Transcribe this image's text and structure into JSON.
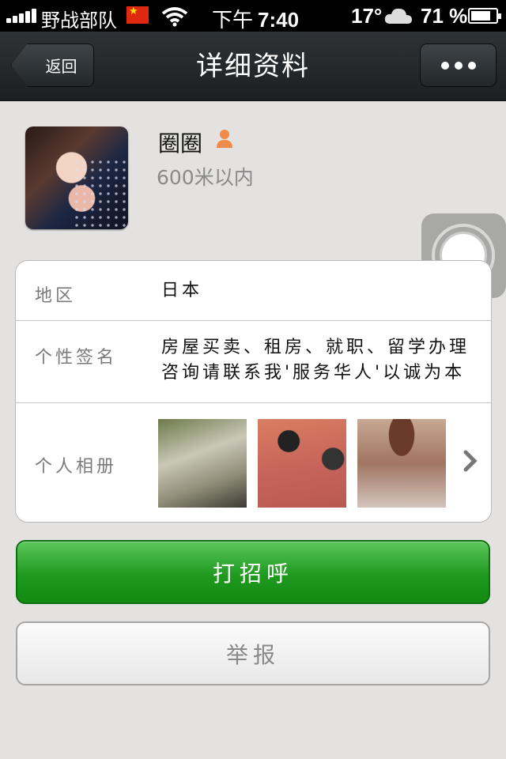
{
  "status_bar": {
    "carrier": "野战部队",
    "time_prefix": "下午",
    "time": "7:40",
    "temperature": "17°",
    "battery_percent": "71 %",
    "signal_bars": 5
  },
  "nav": {
    "back_label": "返回",
    "title": "详细资料",
    "more_icon": "ellipsis-icon"
  },
  "profile": {
    "name": "圈圈",
    "gender_icon": "female-person-icon",
    "distance": "600米以内"
  },
  "details": {
    "region_label": "地区",
    "region_value": "日本",
    "signature_label": "个性签名",
    "signature_value": "房屋买卖、租房、就职、留学办理咨询请联系我'服务华人'以诚为本",
    "album_label": "个人相册"
  },
  "actions": {
    "greet_label": "打招呼",
    "report_label": "举报"
  },
  "colors": {
    "nav_bg": "#1f2326",
    "greet_green": "#1f9a1f",
    "page_bg": "#e3e2e0"
  }
}
